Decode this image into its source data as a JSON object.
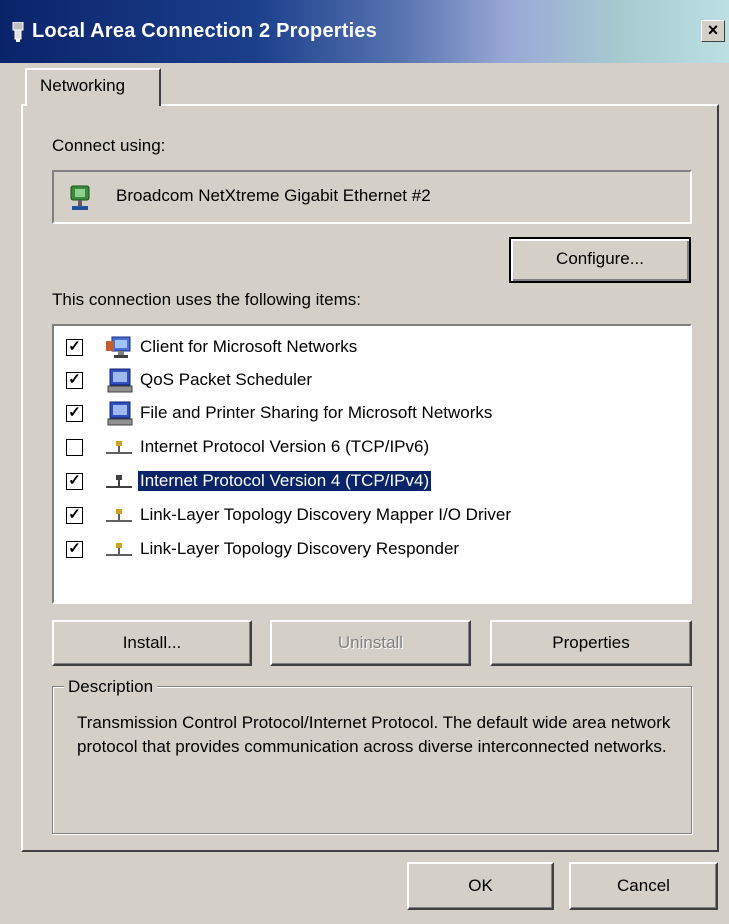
{
  "window": {
    "title": "Local Area Connection 2 Properties",
    "close_label": "×"
  },
  "tabs": [
    {
      "label": "Networking"
    }
  ],
  "connect": {
    "label": "Connect using:",
    "adapter": "Broadcom NetXtreme Gigabit Ethernet #2",
    "adapter_icon": "network-adapter-icon",
    "configure_label": "Configure..."
  },
  "items": {
    "label": "This connection uses the following items:",
    "list": [
      {
        "label": "Client for Microsoft Networks",
        "checked": true,
        "icon": "network-client-icon"
      },
      {
        "label": "QoS Packet Scheduler",
        "checked": true,
        "icon": "service-icon"
      },
      {
        "label": "File and Printer Sharing for Microsoft Networks",
        "checked": true,
        "icon": "service-icon"
      },
      {
        "label": "Internet Protocol Version 6 (TCP/IPv6)",
        "checked": false,
        "icon": "protocol-icon"
      },
      {
        "label": "Internet Protocol Version 4 (TCP/IPv4)",
        "checked": true,
        "icon": "protocol-icon",
        "selected": true
      },
      {
        "label": "Link-Layer Topology Discovery Mapper I/O Driver",
        "checked": true,
        "icon": "protocol-icon"
      },
      {
        "label": "Link-Layer Topology Discovery Responder",
        "checked": true,
        "icon": "protocol-icon"
      }
    ]
  },
  "buttons": {
    "install": "Install...",
    "uninstall": "Uninstall",
    "properties": "Properties",
    "ok": "OK",
    "cancel": "Cancel"
  },
  "description": {
    "legend": "Description",
    "text": "Transmission Control Protocol/Internet Protocol. The default wide area network protocol that provides communication across diverse interconnected networks."
  },
  "colors": {
    "title_gradient_start": "#0a246a",
    "selection": "#0a246a",
    "face": "#d4d0c8"
  }
}
